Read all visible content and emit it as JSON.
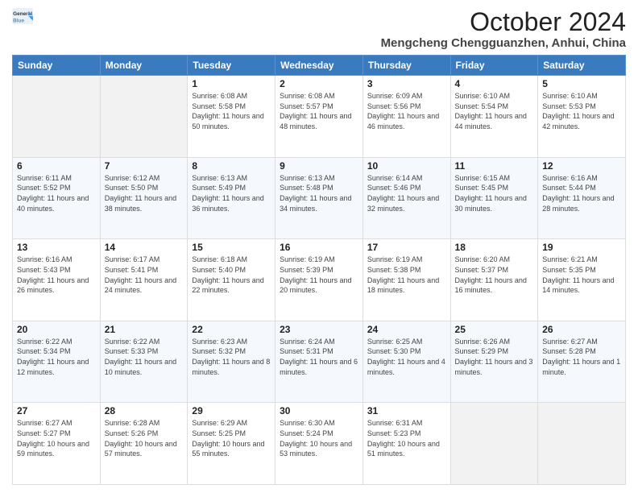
{
  "logo": {
    "line1": "General",
    "line2": "Blue"
  },
  "title": "October 2024",
  "subtitle": "Mengcheng Chengguanzhen, Anhui, China",
  "days_of_week": [
    "Sunday",
    "Monday",
    "Tuesday",
    "Wednesday",
    "Thursday",
    "Friday",
    "Saturday"
  ],
  "weeks": [
    [
      {
        "day": "",
        "info": ""
      },
      {
        "day": "",
        "info": ""
      },
      {
        "day": "1",
        "sunrise": "Sunrise: 6:08 AM",
        "sunset": "Sunset: 5:58 PM",
        "daylight": "Daylight: 11 hours and 50 minutes."
      },
      {
        "day": "2",
        "sunrise": "Sunrise: 6:08 AM",
        "sunset": "Sunset: 5:57 PM",
        "daylight": "Daylight: 11 hours and 48 minutes."
      },
      {
        "day": "3",
        "sunrise": "Sunrise: 6:09 AM",
        "sunset": "Sunset: 5:56 PM",
        "daylight": "Daylight: 11 hours and 46 minutes."
      },
      {
        "day": "4",
        "sunrise": "Sunrise: 6:10 AM",
        "sunset": "Sunset: 5:54 PM",
        "daylight": "Daylight: 11 hours and 44 minutes."
      },
      {
        "day": "5",
        "sunrise": "Sunrise: 6:10 AM",
        "sunset": "Sunset: 5:53 PM",
        "daylight": "Daylight: 11 hours and 42 minutes."
      }
    ],
    [
      {
        "day": "6",
        "sunrise": "Sunrise: 6:11 AM",
        "sunset": "Sunset: 5:52 PM",
        "daylight": "Daylight: 11 hours and 40 minutes."
      },
      {
        "day": "7",
        "sunrise": "Sunrise: 6:12 AM",
        "sunset": "Sunset: 5:50 PM",
        "daylight": "Daylight: 11 hours and 38 minutes."
      },
      {
        "day": "8",
        "sunrise": "Sunrise: 6:13 AM",
        "sunset": "Sunset: 5:49 PM",
        "daylight": "Daylight: 11 hours and 36 minutes."
      },
      {
        "day": "9",
        "sunrise": "Sunrise: 6:13 AM",
        "sunset": "Sunset: 5:48 PM",
        "daylight": "Daylight: 11 hours and 34 minutes."
      },
      {
        "day": "10",
        "sunrise": "Sunrise: 6:14 AM",
        "sunset": "Sunset: 5:46 PM",
        "daylight": "Daylight: 11 hours and 32 minutes."
      },
      {
        "day": "11",
        "sunrise": "Sunrise: 6:15 AM",
        "sunset": "Sunset: 5:45 PM",
        "daylight": "Daylight: 11 hours and 30 minutes."
      },
      {
        "day": "12",
        "sunrise": "Sunrise: 6:16 AM",
        "sunset": "Sunset: 5:44 PM",
        "daylight": "Daylight: 11 hours and 28 minutes."
      }
    ],
    [
      {
        "day": "13",
        "sunrise": "Sunrise: 6:16 AM",
        "sunset": "Sunset: 5:43 PM",
        "daylight": "Daylight: 11 hours and 26 minutes."
      },
      {
        "day": "14",
        "sunrise": "Sunrise: 6:17 AM",
        "sunset": "Sunset: 5:41 PM",
        "daylight": "Daylight: 11 hours and 24 minutes."
      },
      {
        "day": "15",
        "sunrise": "Sunrise: 6:18 AM",
        "sunset": "Sunset: 5:40 PM",
        "daylight": "Daylight: 11 hours and 22 minutes."
      },
      {
        "day": "16",
        "sunrise": "Sunrise: 6:19 AM",
        "sunset": "Sunset: 5:39 PM",
        "daylight": "Daylight: 11 hours and 20 minutes."
      },
      {
        "day": "17",
        "sunrise": "Sunrise: 6:19 AM",
        "sunset": "Sunset: 5:38 PM",
        "daylight": "Daylight: 11 hours and 18 minutes."
      },
      {
        "day": "18",
        "sunrise": "Sunrise: 6:20 AM",
        "sunset": "Sunset: 5:37 PM",
        "daylight": "Daylight: 11 hours and 16 minutes."
      },
      {
        "day": "19",
        "sunrise": "Sunrise: 6:21 AM",
        "sunset": "Sunset: 5:35 PM",
        "daylight": "Daylight: 11 hours and 14 minutes."
      }
    ],
    [
      {
        "day": "20",
        "sunrise": "Sunrise: 6:22 AM",
        "sunset": "Sunset: 5:34 PM",
        "daylight": "Daylight: 11 hours and 12 minutes."
      },
      {
        "day": "21",
        "sunrise": "Sunrise: 6:22 AM",
        "sunset": "Sunset: 5:33 PM",
        "daylight": "Daylight: 11 hours and 10 minutes."
      },
      {
        "day": "22",
        "sunrise": "Sunrise: 6:23 AM",
        "sunset": "Sunset: 5:32 PM",
        "daylight": "Daylight: 11 hours and 8 minutes."
      },
      {
        "day": "23",
        "sunrise": "Sunrise: 6:24 AM",
        "sunset": "Sunset: 5:31 PM",
        "daylight": "Daylight: 11 hours and 6 minutes."
      },
      {
        "day": "24",
        "sunrise": "Sunrise: 6:25 AM",
        "sunset": "Sunset: 5:30 PM",
        "daylight": "Daylight: 11 hours and 4 minutes."
      },
      {
        "day": "25",
        "sunrise": "Sunrise: 6:26 AM",
        "sunset": "Sunset: 5:29 PM",
        "daylight": "Daylight: 11 hours and 3 minutes."
      },
      {
        "day": "26",
        "sunrise": "Sunrise: 6:27 AM",
        "sunset": "Sunset: 5:28 PM",
        "daylight": "Daylight: 11 hours and 1 minute."
      }
    ],
    [
      {
        "day": "27",
        "sunrise": "Sunrise: 6:27 AM",
        "sunset": "Sunset: 5:27 PM",
        "daylight": "Daylight: 10 hours and 59 minutes."
      },
      {
        "day": "28",
        "sunrise": "Sunrise: 6:28 AM",
        "sunset": "Sunset: 5:26 PM",
        "daylight": "Daylight: 10 hours and 57 minutes."
      },
      {
        "day": "29",
        "sunrise": "Sunrise: 6:29 AM",
        "sunset": "Sunset: 5:25 PM",
        "daylight": "Daylight: 10 hours and 55 minutes."
      },
      {
        "day": "30",
        "sunrise": "Sunrise: 6:30 AM",
        "sunset": "Sunset: 5:24 PM",
        "daylight": "Daylight: 10 hours and 53 minutes."
      },
      {
        "day": "31",
        "sunrise": "Sunrise: 6:31 AM",
        "sunset": "Sunset: 5:23 PM",
        "daylight": "Daylight: 10 hours and 51 minutes."
      },
      {
        "day": "",
        "info": ""
      },
      {
        "day": "",
        "info": ""
      }
    ]
  ]
}
